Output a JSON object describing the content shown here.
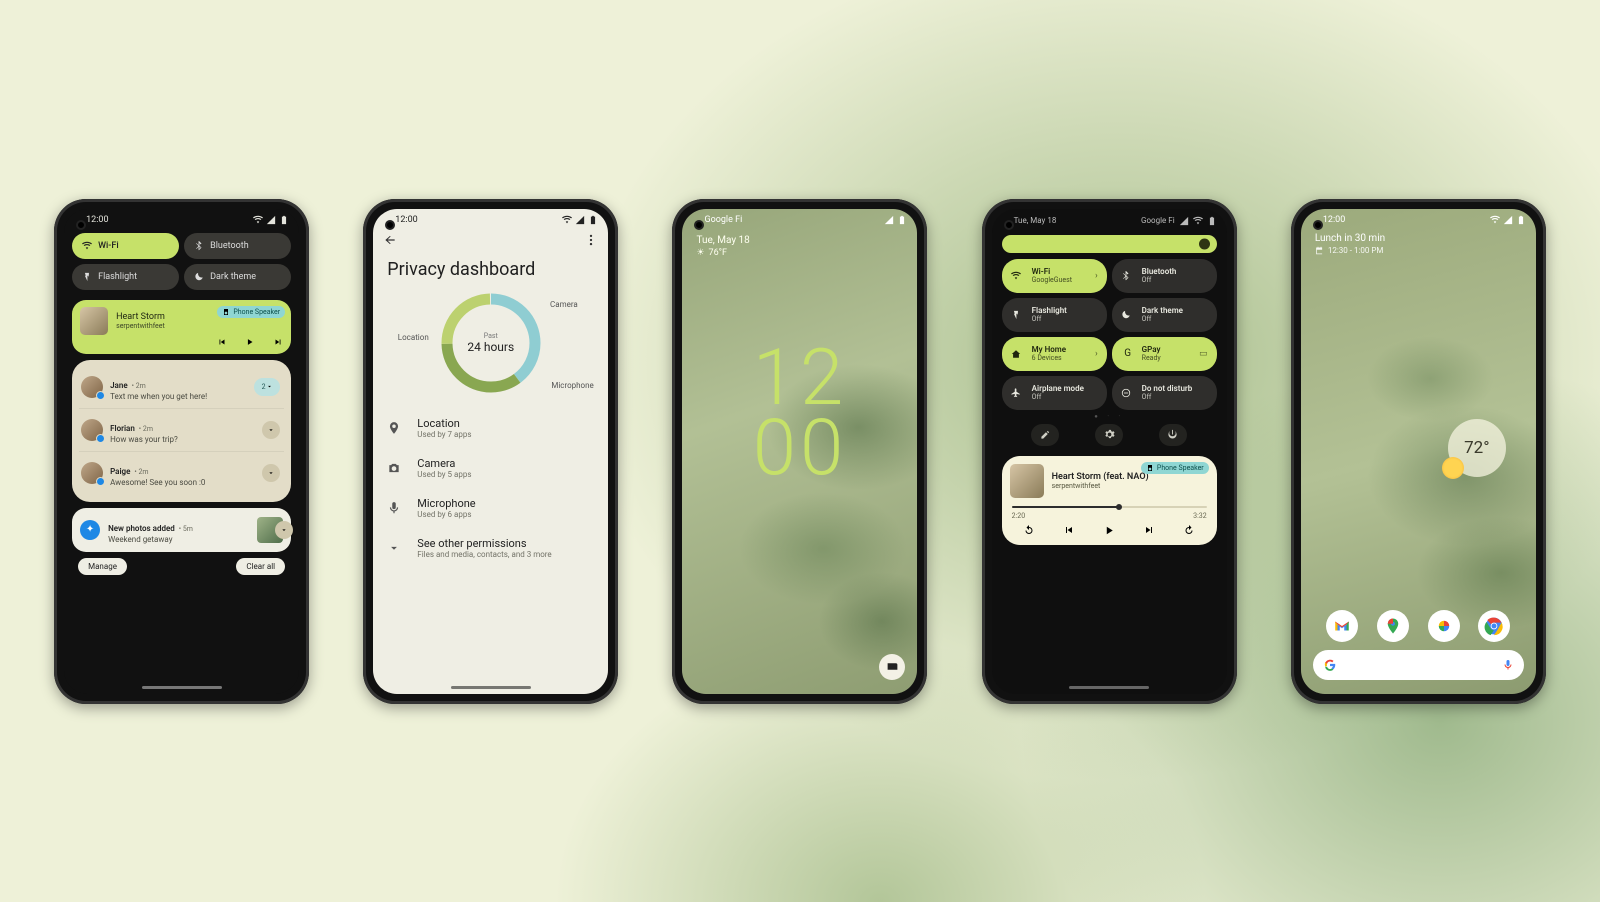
{
  "common": {
    "time": "12:00"
  },
  "phone1": {
    "time": "12:00",
    "qs": [
      {
        "icon": "wifi-icon",
        "label": "Wi-Fi",
        "on": true
      },
      {
        "icon": "bluetooth-icon",
        "label": "Bluetooth",
        "on": false
      },
      {
        "icon": "flashlight-icon",
        "label": "Flashlight",
        "on": false
      },
      {
        "icon": "darktheme-icon",
        "label": "Dark theme",
        "on": false
      }
    ],
    "media": {
      "title": "Heart Storm",
      "artist": "serpentwithfeet",
      "chip": "Phone Speaker"
    },
    "notifs": [
      {
        "name": "Jane",
        "meta": "• 2m",
        "msg": "Text me when you get here!",
        "count": "2"
      },
      {
        "name": "Florian",
        "meta": "• 2m",
        "msg": "How was your trip?"
      },
      {
        "name": "Paige",
        "meta": "• 2m",
        "msg": "Awesome! See you soon :0"
      }
    ],
    "photos": {
      "title": "New photos added",
      "meta": "• 5m",
      "sub": "Weekend getaway"
    },
    "manage": "Manage",
    "clear": "Clear all"
  },
  "phone2": {
    "time": "12:00",
    "title": "Privacy dashboard",
    "ring": {
      "center_small": "Past",
      "center_large": "24 hours",
      "labels": {
        "loc": "Location",
        "cam": "Camera",
        "mic": "Microphone"
      }
    },
    "items": [
      {
        "icon": "location-icon",
        "title": "Location",
        "sub": "Used by 7 apps"
      },
      {
        "icon": "camera-icon",
        "title": "Camera",
        "sub": "Used by 5 apps"
      },
      {
        "icon": "mic-icon",
        "title": "Microphone",
        "sub": "Used by 6 apps"
      },
      {
        "icon": "expand-icon",
        "title": "See other permissions",
        "sub": "Files and media, contacts, and 3 more"
      }
    ]
  },
  "phone3": {
    "carrier": "Google Fi",
    "date": "Tue, May 18",
    "temp": "76°F",
    "clock_top": "12",
    "clock_bot": "00"
  },
  "phone4": {
    "date": "Tue, May 18",
    "carrier": "Google Fi",
    "tiles": [
      {
        "icon": "wifi-icon",
        "title": "Wi-Fi",
        "sub": "GoogleGuest",
        "on": true,
        "arrow": true
      },
      {
        "icon": "bluetooth-icon",
        "title": "Bluetooth",
        "sub": "Off",
        "on": false
      },
      {
        "icon": "flashlight-icon",
        "title": "Flashlight",
        "sub": "Off",
        "on": false
      },
      {
        "icon": "darktheme-icon",
        "title": "Dark theme",
        "sub": "Off",
        "on": false
      },
      {
        "icon": "home-icon",
        "title": "My Home",
        "sub": "6 Devices",
        "on": true,
        "arrow": true
      },
      {
        "icon": "gpay-icon",
        "title": "GPay",
        "sub": "Ready",
        "on": true,
        "card": true
      },
      {
        "icon": "airplane-icon",
        "title": "Airplane mode",
        "sub": "Off",
        "on": false
      },
      {
        "icon": "dnd-icon",
        "title": "Do not disturb",
        "sub": "Off",
        "on": false
      }
    ],
    "media": {
      "title": "Heart Storm (feat. NAO)",
      "artist": "serpentwithfeet",
      "chip": "Phone Speaker",
      "elapsed": "2:20",
      "total": "3:32"
    }
  },
  "phone5": {
    "time": "12:00",
    "glance_title": "Lunch in 30 min",
    "glance_sub": "12:30 - 1:00 PM",
    "temp": "72°",
    "dock": [
      "gmail",
      "maps",
      "photos",
      "chrome"
    ]
  }
}
